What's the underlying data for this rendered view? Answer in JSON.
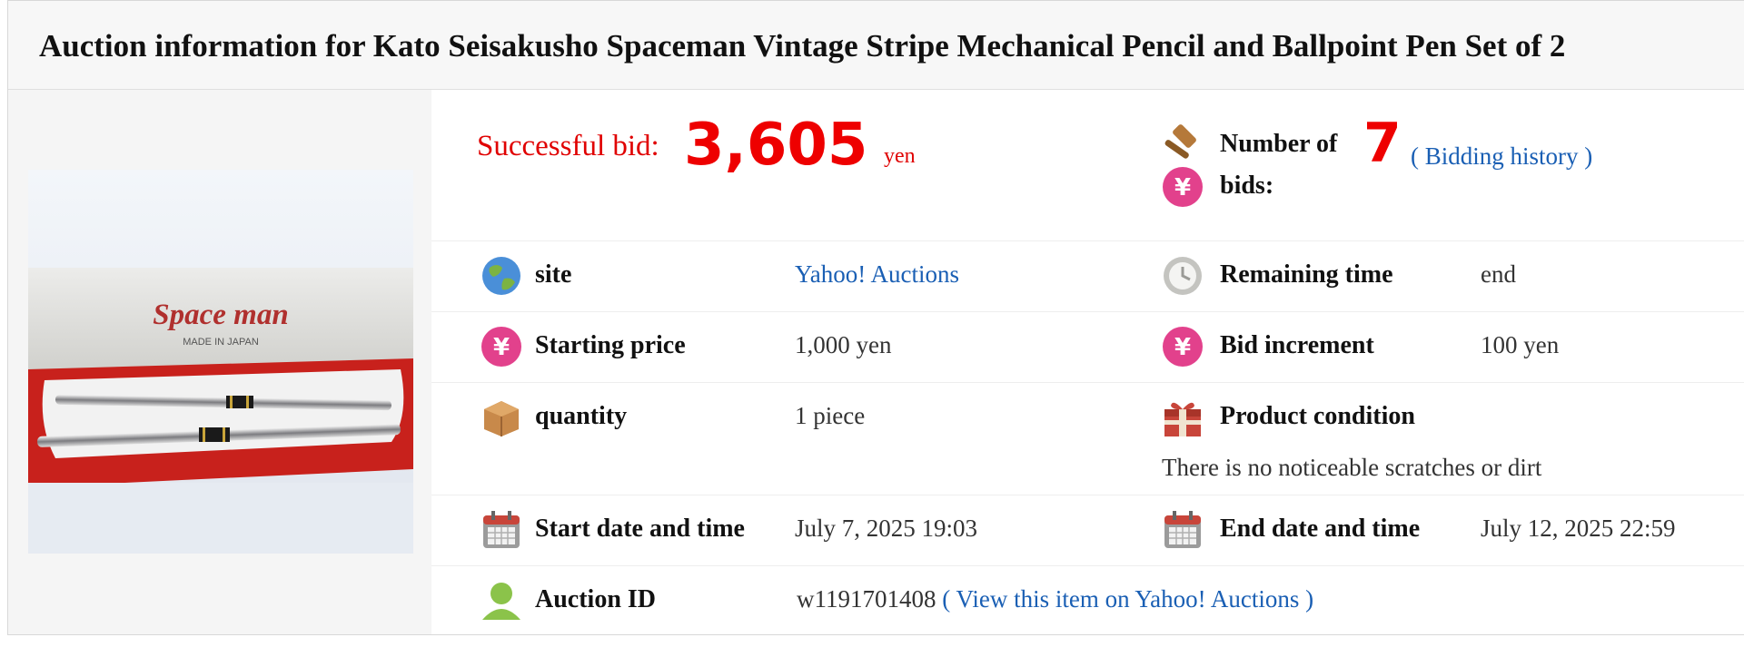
{
  "title": "Auction information for Kato Seisakusho Spaceman Vintage Stripe Mechanical Pencil and Ballpoint Pen Set of 2",
  "photo": {
    "brand_text": "Space man",
    "made_in_text": "MADE IN JAPAN"
  },
  "bid": {
    "label": "Successful bid:",
    "amount": "3,605",
    "unit": "yen"
  },
  "bids": {
    "label_line1": "Number of",
    "label_line2": "bids:",
    "count": "7",
    "open_paren": "(",
    "history_link": "Bidding history",
    "close_paren": ")"
  },
  "site": {
    "label": "site",
    "value": "Yahoo! Auctions"
  },
  "remaining": {
    "label": "Remaining time",
    "value": "end"
  },
  "starting_price": {
    "label": "Starting price",
    "value": "1,000 yen"
  },
  "increment": {
    "label": "Bid increment",
    "value": "100 yen"
  },
  "quantity": {
    "label": "quantity",
    "value": "1 piece"
  },
  "condition": {
    "label": "Product condition",
    "value": "There is no noticeable scratches or dirt"
  },
  "start": {
    "label": "Start date and time",
    "value": "July 7, 2025 19:03"
  },
  "end": {
    "label": "End date and time",
    "value": "July 12, 2025 22:59"
  },
  "auction_id": {
    "label": "Auction ID",
    "value": "w1191701408",
    "open_paren": "(",
    "link": "View this item on Yahoo! Auctions",
    "close_paren": ")"
  },
  "colors": {
    "accent_red": "#ee0000",
    "link_blue": "#1a5fb4",
    "yen_pink": "#e2418c"
  }
}
